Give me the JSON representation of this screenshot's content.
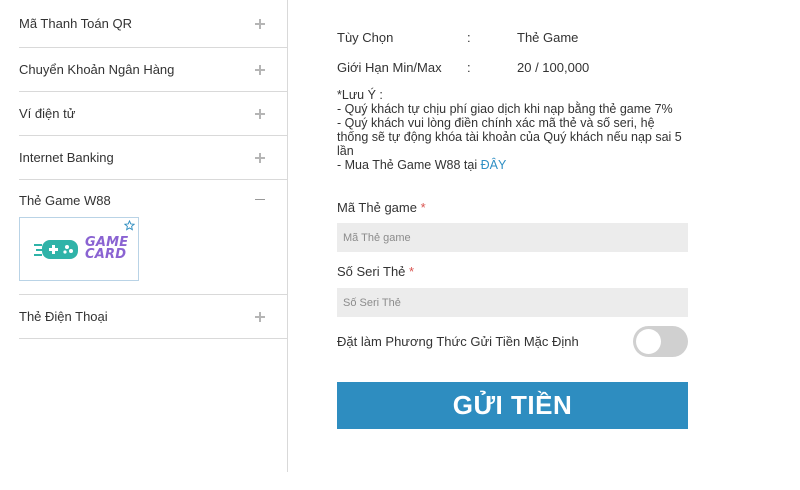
{
  "sidebar": {
    "items": [
      {
        "label": "Mã Thanh Toán QR"
      },
      {
        "label": "Chuyển Khoản Ngân Hàng"
      },
      {
        "label": "Ví điện tử"
      },
      {
        "label": "Internet Banking"
      },
      {
        "label": "Thẻ Game W88",
        "expanded": true,
        "option_logo_text": [
          "GAME",
          "CARD"
        ]
      },
      {
        "label": "Thẻ Điện Thoại"
      }
    ]
  },
  "info": {
    "option_key": "Tùy Chọn",
    "option_value": "Thẻ Game",
    "limit_key": "Giới Hạn Min/Max",
    "limit_value": "20 / 100,000",
    "colon": ":"
  },
  "notes": {
    "title": "*Lưu Ý :",
    "line1": "- Quý khách tự chịu phí giao dịch khi nạp bằng thẻ game 7%",
    "line2": "- Quý khách vui lòng điền chính xác mã thẻ và số seri, hệ thống sẽ tự động khóa tài khoản của Quý khách nếu nạp sai 5 lần",
    "line3_prefix": "- Mua Thẻ Game W88 tại",
    "line3_link": "ĐÂY"
  },
  "form": {
    "card_code_label": "Mã Thẻ game",
    "card_code_placeholder": "Mã Thẻ game",
    "serial_label": "Số Seri Thẻ",
    "serial_placeholder": "Số Seri Thẻ",
    "required_mark": "*",
    "default_method_label": "Đặt làm Phương Thức Gửi Tiền Mặc Định",
    "default_method_on": false,
    "submit_label": "GỬI TIỀN"
  },
  "colors": {
    "accent": "#2e8dc0",
    "link": "#2f8fc4",
    "required": "#d9534f",
    "gamecard_purple": "#8a63d2",
    "gamecard_teal": "#2fb3a8"
  }
}
